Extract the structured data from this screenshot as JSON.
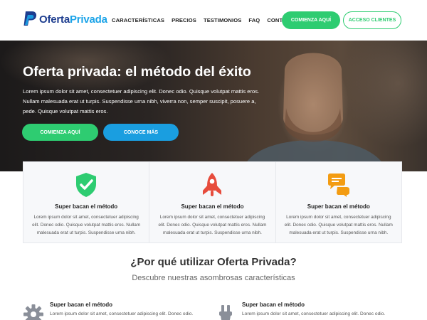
{
  "header": {
    "logo": {
      "part1": "Oferta",
      "part2": "Privada"
    },
    "nav": [
      "CARACTERÍSTICAS",
      "PRECIOS",
      "TESTIMONIOS",
      "FAQ",
      "CONTACTO"
    ],
    "btn_start": "COMIENZA AQUÍ",
    "btn_clients": "ACCESO CLIENTES"
  },
  "hero": {
    "title": "Oferta privada: el método del éxito",
    "text": "Lorem ipsum dolor sit amet, consectetuer adipiscing elit. Donec odio. Quisque volutpat mattis eros. Nullam malesuada erat ut turpis. Suspendisse urna nibh, viverra non, semper suscipit, posuere a, pede. Quisque volutpat mattis eros.",
    "btn_start": "COMIENZA AQUÍ",
    "btn_more": "CONOCE MÁS"
  },
  "cards": [
    {
      "icon": "shield-check-icon",
      "title": "Super bacan el método",
      "text": "Lorem ipsum dolor sit amet, consectetuer adipiscing elit. Donec odio. Quisque volutpat mattis eros. Nullam malesuada erat ut turpis. Suspendisse urna nibh."
    },
    {
      "icon": "rocket-icon",
      "title": "Super bacan el método",
      "text": "Lorem ipsum dolor sit amet, consectetuer adipiscing elit. Donec odio. Quisque volutpat mattis eros. Nullam malesuada erat ut turpis. Suspendisse urna nibh."
    },
    {
      "icon": "chat-bubbles-icon",
      "title": "Super bacan el método",
      "text": "Lorem ipsum dolor sit amet, consectetuer adipiscing elit. Donec odio. Quisque volutpat mattis eros. Nullam malesuada erat ut turpis. Suspendisse urna nibh."
    }
  ],
  "why": {
    "title": "¿Por qué utilizar Oferta Privada?",
    "subtitle": "Descubre nuestras asombrosas características"
  },
  "features": [
    {
      "icon": "gear-icon",
      "title": "Super bacan el método",
      "text": "Lorem ipsum dolor sit amet, consectetuer adipiscing elit. Donec odio."
    },
    {
      "icon": "tool-icon",
      "title": "Super bacan el método",
      "text": "Lorem ipsum dolor sit amet, consectetuer adipiscing elit. Donec odio."
    }
  ],
  "colors": {
    "green": "#2ecc71",
    "blue": "#1a9ee0",
    "logo_dark": "#1d3d8f",
    "logo_light": "#1aa3e8",
    "shield": "#2ecc71",
    "rocket": "#e74c3c",
    "chat": "#f39c12",
    "gray_icon": "#8a8f99"
  }
}
